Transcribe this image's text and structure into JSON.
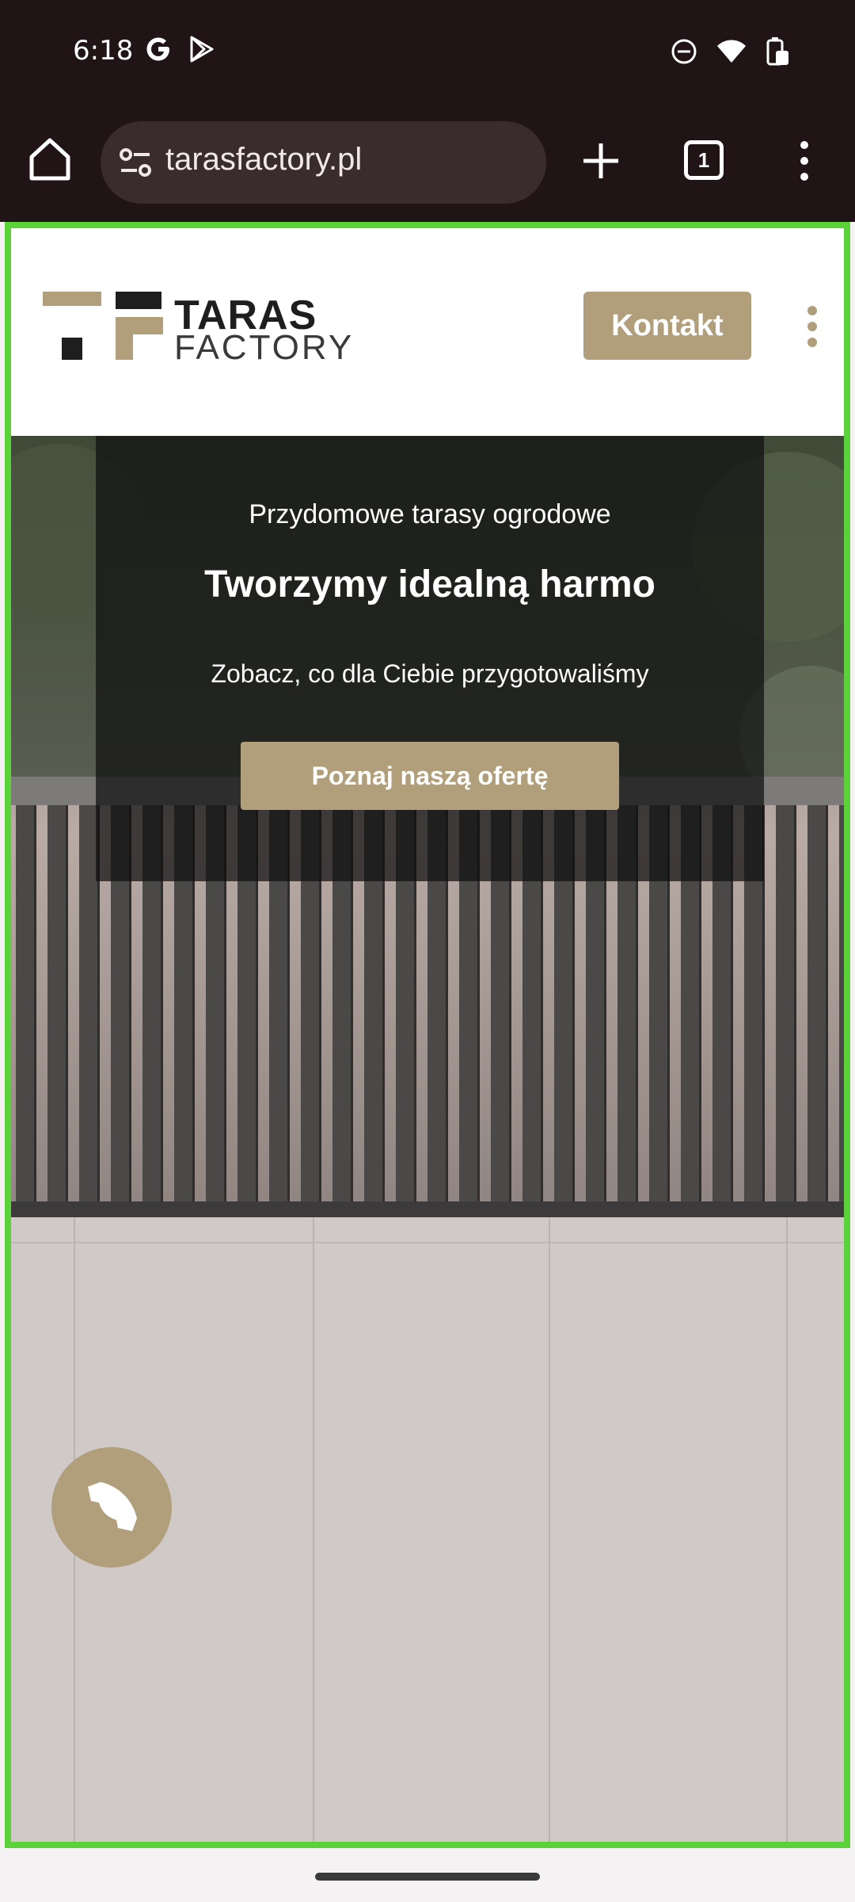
{
  "status_bar": {
    "time": "6:18",
    "left_icons": [
      "google-icon",
      "play-store-icon"
    ],
    "right_icons": [
      "dnd-icon",
      "wifi-icon",
      "battery-icon"
    ]
  },
  "browser": {
    "url": "tarasfactory.pl",
    "tab_count": "1",
    "buttons": [
      "home-icon",
      "site-info-icon",
      "new-tab-icon",
      "tab-switcher",
      "menu-icon"
    ]
  },
  "site": {
    "logo_line1": "TARAS",
    "logo_line2": "FACTORY",
    "contact_button": "Kontakt",
    "hero": {
      "kicker": "Przydomowe tarasy ogrodowe",
      "title": "Tworzymy idealną harmo",
      "subtitle": "Zobacz, co dla Ciebie przygotowaliśmy",
      "cta": "Poznaj naszą ofertę"
    },
    "call_button_icon": "phone-icon"
  },
  "colors": {
    "accent": "#b19f7c",
    "frame": "#5bd13a",
    "system_bar": "#201416"
  }
}
